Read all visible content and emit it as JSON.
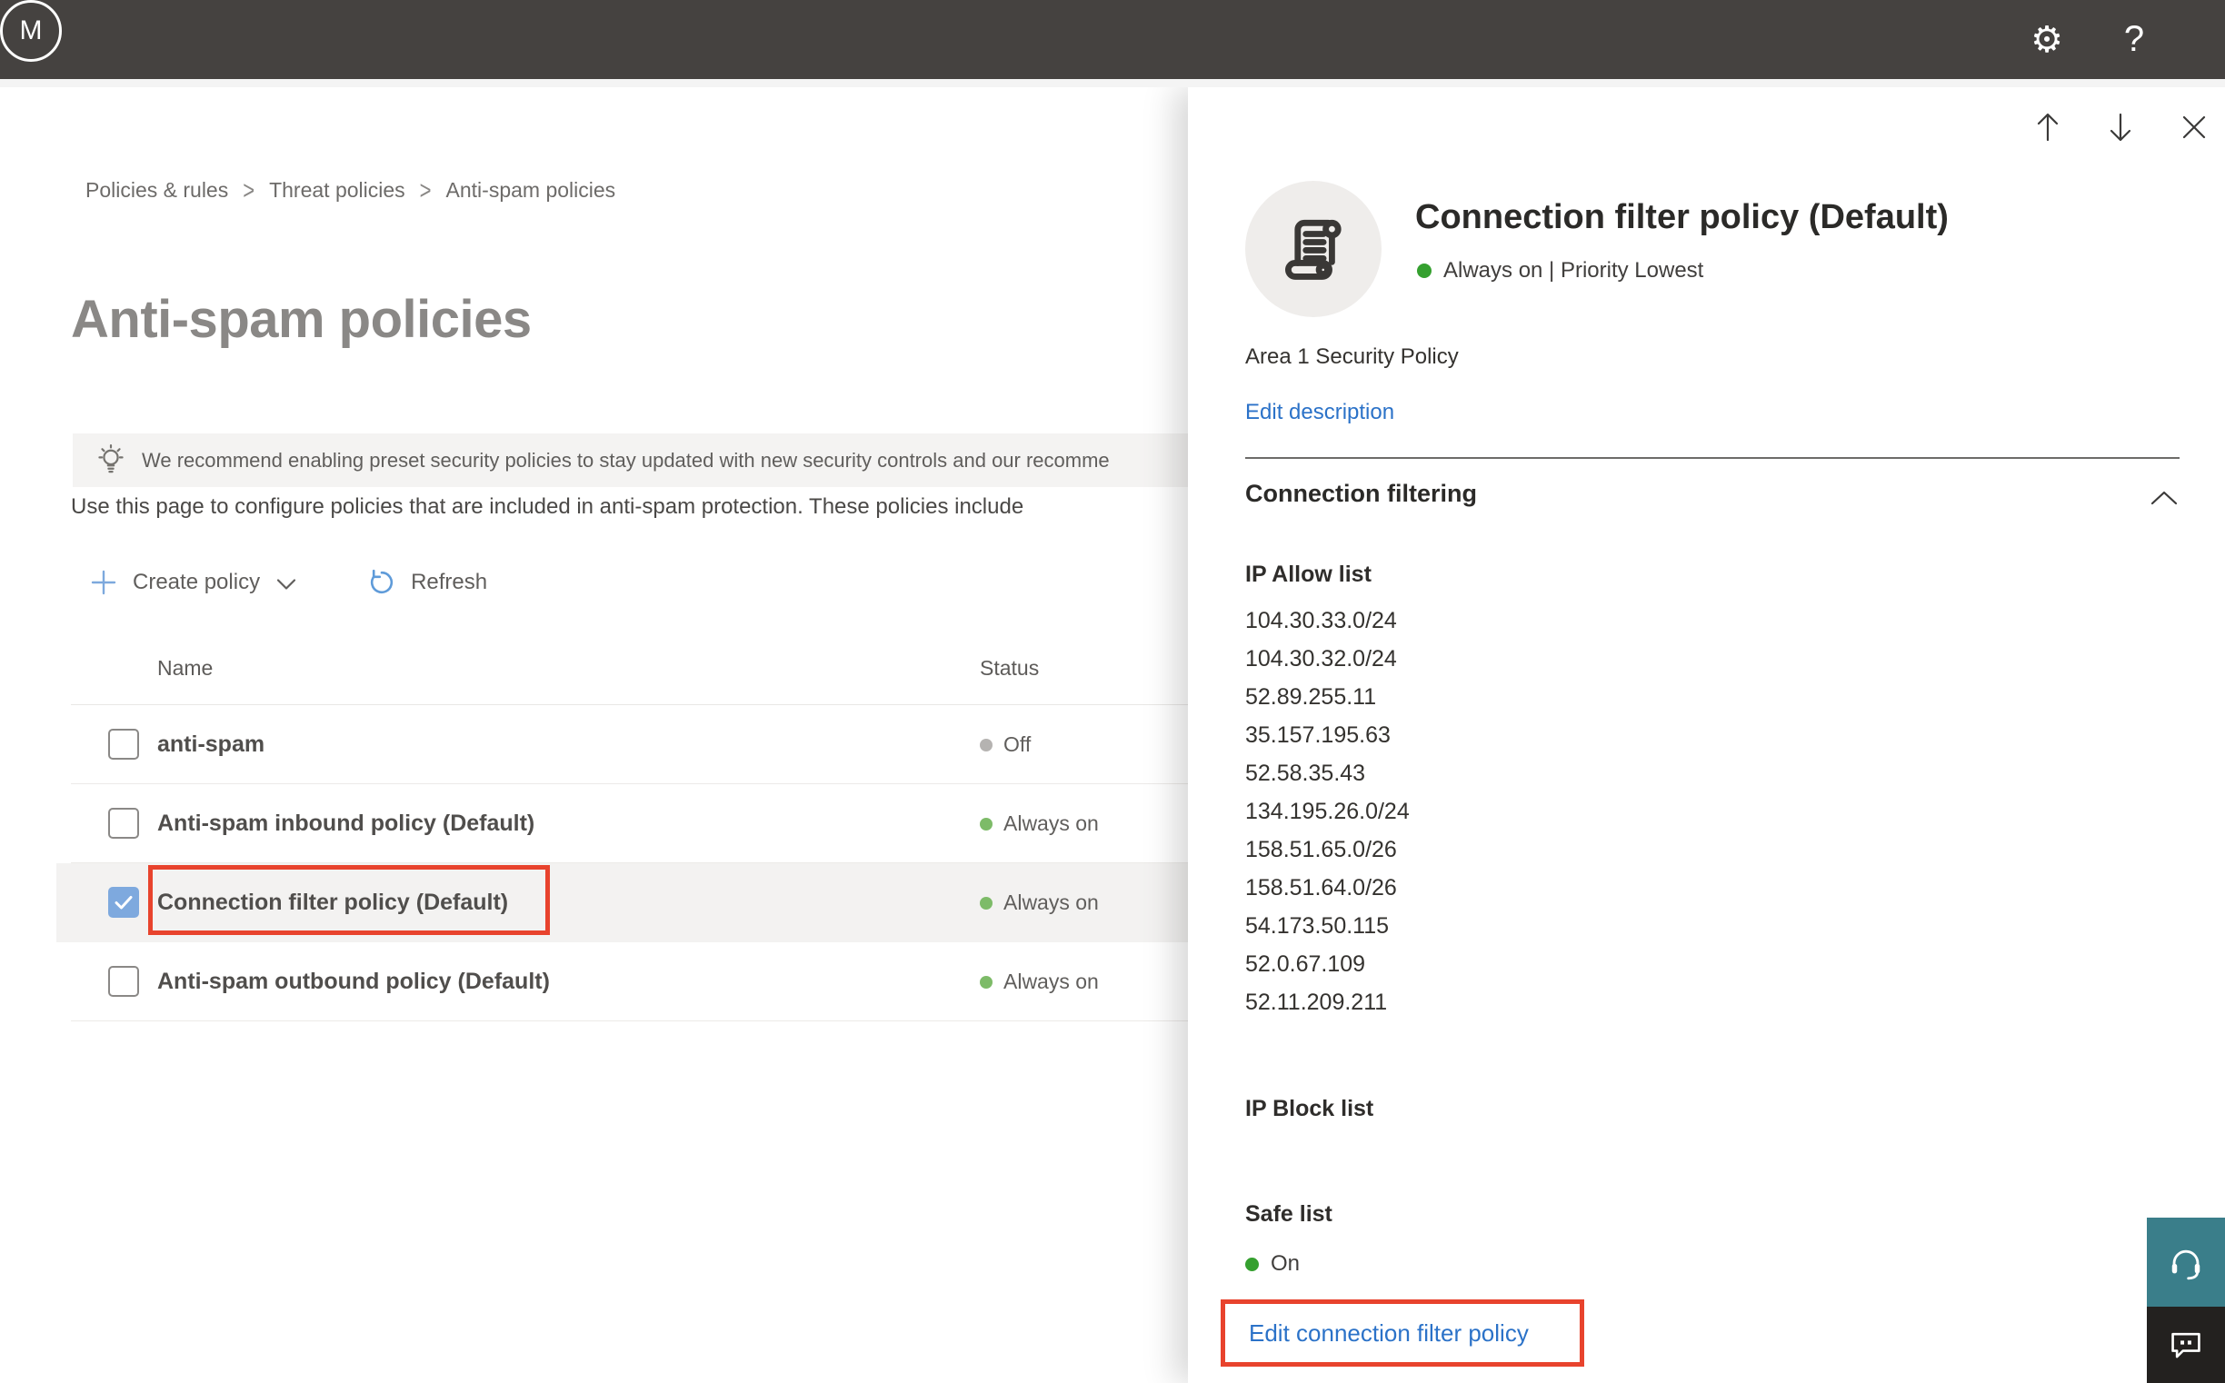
{
  "topbar": {
    "help_label": "?",
    "avatar_initial": "M"
  },
  "breadcrumb": {
    "separator": ">",
    "items": [
      "Policies & rules",
      "Threat policies",
      "Anti-spam policies"
    ]
  },
  "main": {
    "title": "Anti-spam policies",
    "banner_text": "We recommend enabling preset security policies to stay updated with new security controls and our recomme",
    "description": "Use this page to configure policies that are included in anti-spam protection. These policies include",
    "toolbar": {
      "create_policy_label": "Create policy",
      "refresh_label": "Refresh"
    },
    "table": {
      "columns": [
        "Name",
        "Status"
      ],
      "rows": [
        {
          "name": "anti-spam",
          "status": "Off",
          "checked": false,
          "selected": false
        },
        {
          "name": "Anti-spam inbound policy (Default)",
          "status": "Always on",
          "checked": false,
          "selected": false
        },
        {
          "name": "Connection filter policy (Default)",
          "status": "Always on",
          "checked": true,
          "selected": true
        },
        {
          "name": "Anti-spam outbound policy (Default)",
          "status": "Always on",
          "checked": false,
          "selected": false
        }
      ]
    }
  },
  "panel": {
    "title": "Connection filter policy (Default)",
    "status_text": "Always on | Priority Lowest",
    "description": "Area 1 Security Policy",
    "edit_description_label": "Edit description",
    "section": {
      "title": "Connection filtering",
      "ip_allow": {
        "label": "IP Allow list",
        "items": [
          "104.30.33.0/24",
          "104.30.32.0/24",
          "52.89.255.11",
          "35.157.195.63",
          "52.58.35.43",
          "134.195.26.0/24",
          "158.51.65.0/26",
          "158.51.64.0/26",
          "54.173.50.115",
          "52.0.67.109",
          "52.11.209.211"
        ]
      },
      "ip_block": {
        "label": "IP Block list"
      },
      "safe_list": {
        "label": "Safe list",
        "status": "On"
      },
      "edit_link_label": "Edit connection filter policy"
    }
  },
  "colors": {
    "topbar_dark": "#454240",
    "accent_link_blue": "#2b72c8",
    "annotation_red": "#e8432d",
    "status_on_green": "#35a02f",
    "table_on_green": "#7dbb68",
    "status_off_gray": "#b5b3b1",
    "selected_row_bg": "#f3f2f1",
    "support_teal": "#3a7e8a"
  }
}
